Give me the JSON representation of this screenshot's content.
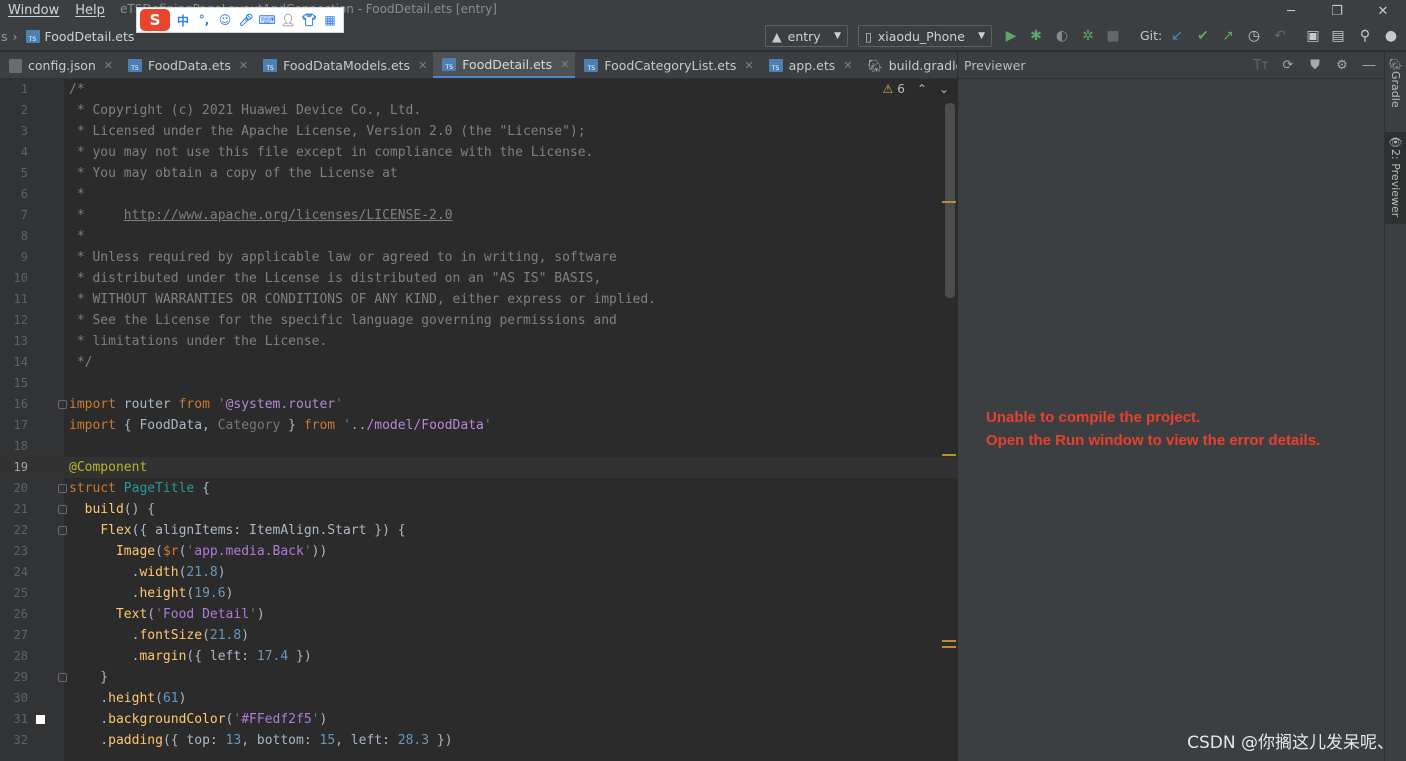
{
  "titlebar": {
    "menus": [
      "Window",
      "Help"
    ],
    "title": "eTSDefiningPageLayoutAndConnection - FoodDetail.ets [entry]"
  },
  "ime": {
    "logo": "S",
    "lang": "中"
  },
  "nav": {
    "crumb_prefix": "s",
    "crumb_file": "FoodDetail.ets",
    "module_select": "entry",
    "device_select": "xiaodu_Phone",
    "git_label": "Git:"
  },
  "tabs": [
    {
      "label": "config.json",
      "icon": "json-file-icon",
      "active": false
    },
    {
      "label": "FoodData.ets",
      "icon": "ts-file-icon",
      "active": false
    },
    {
      "label": "FoodDataModels.ets",
      "icon": "ts-file-icon",
      "active": false
    },
    {
      "label": "FoodDetail.ets",
      "icon": "ts-file-icon",
      "active": true
    },
    {
      "label": "FoodCategoryList.ets",
      "icon": "ts-file-icon",
      "active": false
    },
    {
      "label": "app.ets",
      "icon": "ts-file-icon",
      "active": false
    },
    {
      "label": "build.gradle (eT",
      "icon": "gradle-icon",
      "active": false
    }
  ],
  "editor": {
    "warning_count": "6",
    "current_line": 19,
    "lines": [
      [
        [
          "c-com",
          "/*"
        ]
      ],
      [
        [
          "c-com",
          " * Copyright (c) 2021 Huawei Device Co., Ltd."
        ]
      ],
      [
        [
          "c-com",
          " * Licensed under the Apache License, Version 2.0 (the \"License\");"
        ]
      ],
      [
        [
          "c-com",
          " * you may not use this file except in compliance with the License."
        ]
      ],
      [
        [
          "c-com",
          " * You may obtain a copy of the License at"
        ]
      ],
      [
        [
          "c-com",
          " *"
        ]
      ],
      [
        [
          "c-com",
          " *     "
        ],
        [
          "c-link",
          "http://www.apache.org/licenses/LICENSE-2.0"
        ]
      ],
      [
        [
          "c-com",
          " *"
        ]
      ],
      [
        [
          "c-com",
          " * Unless required by applicable law or agreed to in writing, software"
        ]
      ],
      [
        [
          "c-com",
          " * distributed under the License is distributed on an \"AS IS\" BASIS,"
        ]
      ],
      [
        [
          "c-com",
          " * WITHOUT WARRANTIES OR CONDITIONS OF ANY KIND, either express or implied."
        ]
      ],
      [
        [
          "c-com",
          " * See the License for the specific language governing permissions and"
        ]
      ],
      [
        [
          "c-com",
          " * limitations under the License."
        ]
      ],
      [
        [
          "c-com",
          " */"
        ]
      ],
      [],
      [
        [
          "c-kw",
          "import"
        ],
        [
          "c-plain",
          " router "
        ],
        [
          "c-kw",
          "from"
        ],
        [
          "c-plain",
          " "
        ],
        [
          "c-str",
          "'"
        ],
        [
          "c-path",
          "@system.router"
        ],
        [
          "c-str",
          "'"
        ]
      ],
      [
        [
          "c-kw",
          "import"
        ],
        [
          "c-plain",
          " { FoodData, "
        ],
        [
          "c-dim",
          "Category"
        ],
        [
          "c-plain",
          " } "
        ],
        [
          "c-kw",
          "from"
        ],
        [
          "c-plain",
          " "
        ],
        [
          "c-str",
          "'"
        ],
        [
          "c-path",
          "../model/FoodData"
        ],
        [
          "c-str",
          "'"
        ]
      ],
      [],
      [
        [
          "c-ann",
          "@Component"
        ]
      ],
      [
        [
          "c-kw",
          "struct"
        ],
        [
          "c-plain",
          " "
        ],
        [
          "c-teal",
          "PageTitle"
        ],
        [
          "c-plain",
          " {"
        ]
      ],
      [
        [
          "c-plain",
          "  "
        ],
        [
          "c-comp",
          "build"
        ],
        [
          "c-plain",
          "() {"
        ]
      ],
      [
        [
          "c-plain",
          "    "
        ],
        [
          "c-comp",
          "Flex"
        ],
        [
          "c-plain",
          "({ "
        ],
        [
          "c-plain",
          "alignItems: ItemAlign.Start"
        ],
        [
          "c-plain",
          " }) {"
        ]
      ],
      [
        [
          "c-plain",
          "      "
        ],
        [
          "c-comp",
          "Image"
        ],
        [
          "c-plain",
          "("
        ],
        [
          "c-kw",
          "$r"
        ],
        [
          "c-plain",
          "("
        ],
        [
          "c-str",
          "'"
        ],
        [
          "c-purple",
          "app.media.Back"
        ],
        [
          "c-str",
          "'"
        ],
        [
          "c-plain",
          "))"
        ]
      ],
      [
        [
          "c-plain",
          "        ."
        ],
        [
          "c-comp",
          "width"
        ],
        [
          "c-plain",
          "("
        ],
        [
          "c-num",
          "21.8"
        ],
        [
          "c-plain",
          ")"
        ]
      ],
      [
        [
          "c-plain",
          "        ."
        ],
        [
          "c-comp",
          "height"
        ],
        [
          "c-plain",
          "("
        ],
        [
          "c-num",
          "19.6"
        ],
        [
          "c-plain",
          ")"
        ]
      ],
      [
        [
          "c-plain",
          "      "
        ],
        [
          "c-comp",
          "Text"
        ],
        [
          "c-plain",
          "("
        ],
        [
          "c-str",
          "'"
        ],
        [
          "c-purple",
          "Food Detail"
        ],
        [
          "c-str",
          "'"
        ],
        [
          "c-plain",
          ")"
        ]
      ],
      [
        [
          "c-plain",
          "        ."
        ],
        [
          "c-comp",
          "fontSize"
        ],
        [
          "c-plain",
          "("
        ],
        [
          "c-num",
          "21.8"
        ],
        [
          "c-plain",
          ")"
        ]
      ],
      [
        [
          "c-plain",
          "        ."
        ],
        [
          "c-comp",
          "margin"
        ],
        [
          "c-plain",
          "({ left: "
        ],
        [
          "c-num",
          "17.4"
        ],
        [
          "c-plain",
          " })"
        ]
      ],
      [
        [
          "c-plain",
          "    }"
        ]
      ],
      [
        [
          "c-plain",
          "    ."
        ],
        [
          "c-comp",
          "height"
        ],
        [
          "c-plain",
          "("
        ],
        [
          "c-num",
          "61"
        ],
        [
          "c-plain",
          ")"
        ]
      ],
      [
        [
          "c-plain",
          "    ."
        ],
        [
          "c-comp",
          "backgroundColor"
        ],
        [
          "c-plain",
          "("
        ],
        [
          "c-str",
          "'"
        ],
        [
          "c-purple",
          "#FFedf2f5"
        ],
        [
          "c-str",
          "'"
        ],
        [
          "c-plain",
          ")"
        ]
      ],
      [
        [
          "c-plain",
          "    ."
        ],
        [
          "c-comp",
          "padding"
        ],
        [
          "c-plain",
          "({ top: "
        ],
        [
          "c-num",
          "13"
        ],
        [
          "c-plain",
          ", bottom: "
        ],
        [
          "c-num",
          "15"
        ],
        [
          "c-plain",
          ", left: "
        ],
        [
          "c-num",
          "28.3"
        ],
        [
          "c-plain",
          " })"
        ]
      ]
    ]
  },
  "previewer": {
    "title": "Previewer",
    "error_line1": "Unable to compile the project.",
    "error_line2": "Open the Run window to view the error details."
  },
  "stripe": {
    "gradle": "Gradle",
    "previewer": "2: Previewer"
  },
  "watermark": "CSDN @你搁这儿发呆呢、"
}
